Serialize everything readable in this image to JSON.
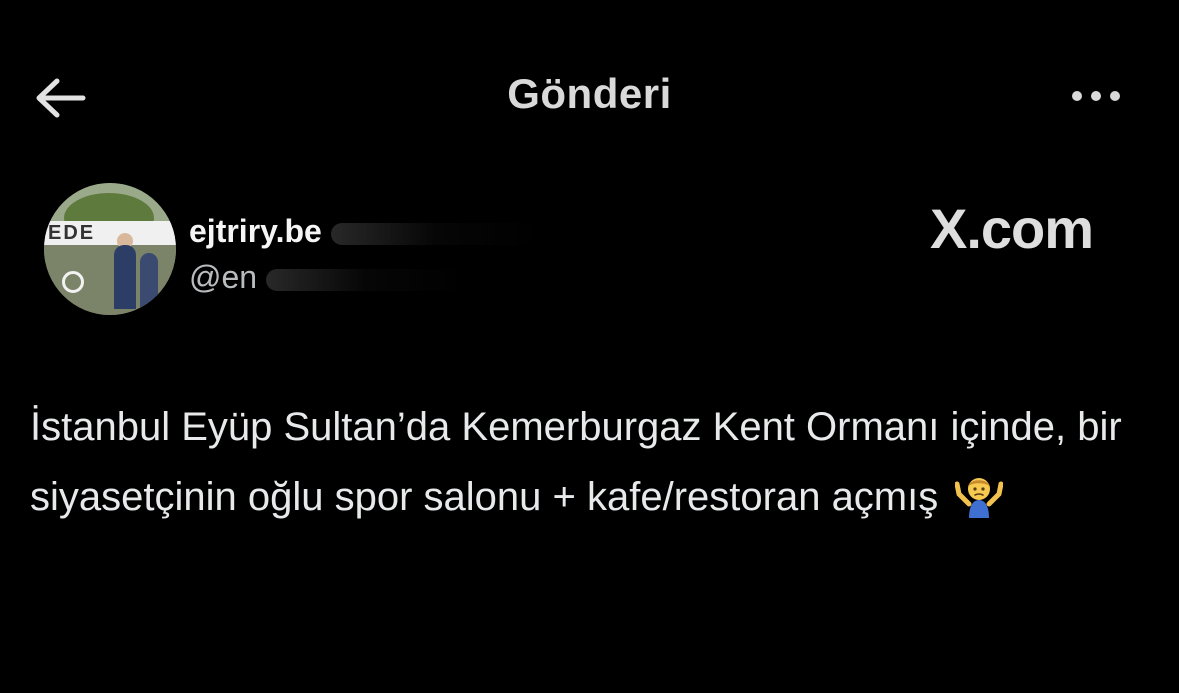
{
  "header": {
    "title": "Gönderi",
    "back_icon": "arrow-left-icon",
    "more_icon": "more-horizontal-icon"
  },
  "author": {
    "display_name": "ejtriry.be",
    "handle": "@en",
    "avatar_sign_text": "EDE"
  },
  "watermark": "X.com",
  "tweet": {
    "text": "İstanbul Eyüp Sultan’da Kemerburgaz Kent Ormanı içinde, bir siyasetçinin oğlu spor salonu + kafe/restoran açmış",
    "emoji": "person-shrugging-icon"
  },
  "colors": {
    "background": "#000000",
    "text": "#e7e9ea",
    "muted": "#b9bcbf"
  }
}
